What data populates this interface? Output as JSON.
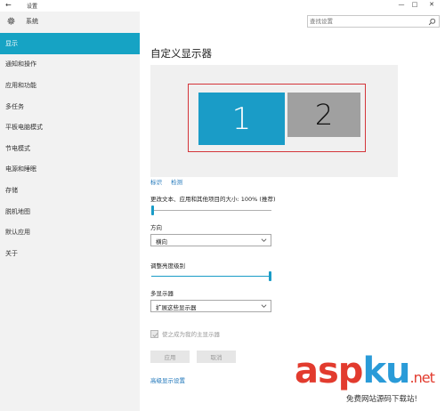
{
  "window": {
    "back_glyph": "←",
    "title": "设置",
    "controls": {
      "minimize": "—",
      "maximize": "□",
      "close": "✕"
    }
  },
  "sidebar": {
    "header_label": "系统",
    "header_icon": "gear-icon",
    "items": [
      {
        "label": "显示",
        "active": true
      },
      {
        "label": "通知和操作"
      },
      {
        "label": "应用和功能"
      },
      {
        "label": "多任务"
      },
      {
        "label": "平板电脑模式"
      },
      {
        "label": "节电模式"
      },
      {
        "label": "电源和睡眠"
      },
      {
        "label": "存储"
      },
      {
        "label": "脱机地图"
      },
      {
        "label": "默认应用"
      },
      {
        "label": "关于"
      }
    ]
  },
  "search": {
    "placeholder": "查找设置",
    "icon": "search-icon"
  },
  "main": {
    "title": "自定义显示器",
    "monitors": [
      {
        "label": "1",
        "selected": true
      },
      {
        "label": "2"
      }
    ],
    "identify_link": "标识",
    "detect_link": "检测",
    "scale_label": "更改文本、应用和其他项目的大小: 100% (推荐)",
    "scale_slider_value": 0,
    "orientation_label": "方向",
    "orientation_value": "横向",
    "brightness_label": "调整亮度级别",
    "brightness_slider_value": 1.0,
    "multi_display_label": "多显示器",
    "multi_display_value": "扩展这些显示器",
    "main_display_checkbox": "使之成为我的主显示器",
    "apply_button": "应用",
    "cancel_button": "取消",
    "advanced_link": "高级显示设置"
  },
  "watermark": {
    "brand_asp": "asp",
    "brand_ku": "ku",
    "brand_net": ".net",
    "subtitle": "免费网站源码下载站!"
  },
  "colors": {
    "accent": "#1a9cc7",
    "sidebar_active": "#16a3c4",
    "link": "#1a73b8",
    "highlight_frame": "#d4353a"
  }
}
